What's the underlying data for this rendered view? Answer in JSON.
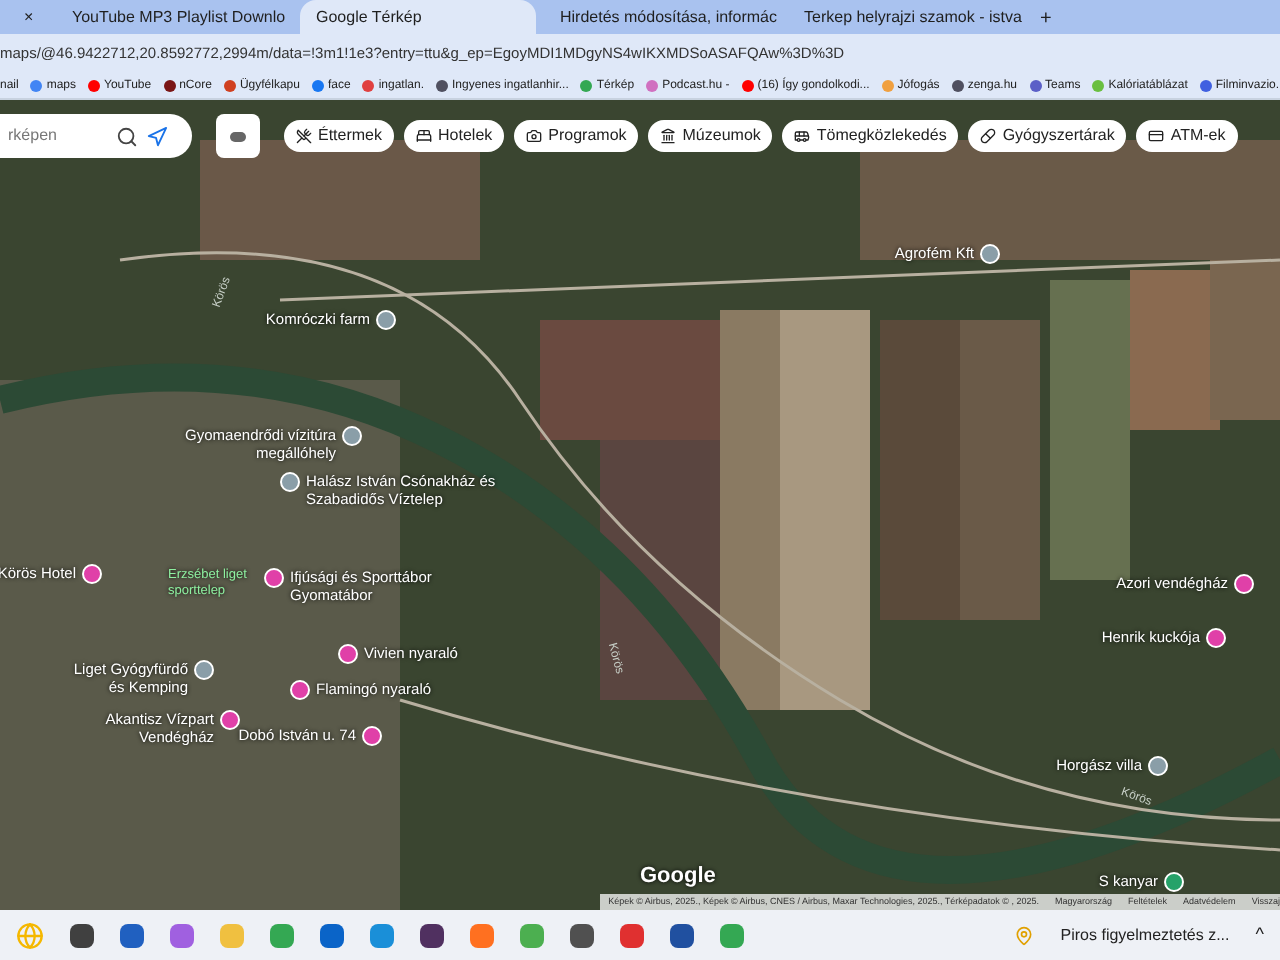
{
  "tabs": [
    {
      "label": "×",
      "selected": false
    },
    {
      "label": "YouTube MP3 Playlist Downlo",
      "selected": false
    },
    {
      "label": "Google Térkép",
      "selected": true
    },
    {
      "label": "Hirdetés módosítása, informác",
      "selected": false
    },
    {
      "label": "Terkep helyrajzi szamok - istva",
      "selected": false
    }
  ],
  "new_tab": "+",
  "address": "maps/@46.9422712,20.8592772,2994m/data=!3m1!1e3?entry=ttu&g_ep=EgoyMDI1MDgyNS4wIKXMDSoASAFQAw%3D%3D",
  "bookmarks": [
    "nail",
    "maps",
    "YouTube",
    "nCore",
    "Ügyfélkapu",
    "face",
    "ingatlan.",
    "Ingyenes ingatlanhir...",
    "Térkép",
    "Podcast.hu -",
    "(16) Így gondolkodi...",
    "Jófogás",
    "zenga.hu",
    "Teams",
    "Kalóriatáblázat",
    "Filminvazio."
  ],
  "map": {
    "search": {
      "placeholder": "rképen"
    },
    "chips": [
      "Éttermek",
      "Hotelek",
      "Programok",
      "Múzeumok",
      "Tömegközlekedés",
      "Gyógyszertárak",
      "ATM-ek"
    ],
    "places": [
      {
        "name": "Komróczki farm",
        "color": "#8a9ea8"
      },
      {
        "name": "Gyomaendrődi vízitúra megállóhely",
        "color": "#8a9ea8"
      },
      {
        "name": "Halász István Csónakház és Szabadidős Víztelep",
        "color": "#8a9ea8"
      },
      {
        "name": "Agrofém Kft",
        "color": "#8a9ea8"
      },
      {
        "name": "Körös Hotel",
        "color": "#e040a8"
      },
      {
        "name": "Ifjúsági és Sporttábor Gyomatábor",
        "color": "#e040a8"
      },
      {
        "name": "Liget Gyógyfürdő és Kemping",
        "color": "#8a9ea8"
      },
      {
        "name": "Vivien nyaraló",
        "color": "#e040a8"
      },
      {
        "name": "Flamingó nyaraló",
        "color": "#e040a8"
      },
      {
        "name": "Akantisz Vízpart Vendégház",
        "color": "#e040a8"
      },
      {
        "name": "Dobó István u. 74",
        "color": "#e040a8"
      },
      {
        "name": "Azori vendégház",
        "color": "#e040a8"
      },
      {
        "name": "Henrik kuckója",
        "color": "#e040a8"
      },
      {
        "name": "Horgász villa",
        "color": "#8a9ea8"
      },
      {
        "name": "S kanyar",
        "color": "#26a269"
      }
    ],
    "park_label": "Erzsébet liget sporttelep",
    "river_labels": [
      "Körös",
      "Körös",
      "Körös"
    ],
    "logo": "Google",
    "attribution": "Képek © Airbus, 2025., Képek © Airbus, CNES / Airbus, Maxar Technologies, 2025., Térképadatok © , 2025.",
    "footer_links": [
      "Magyarország",
      "Feltételek",
      "Adatvédelem",
      "Visszaj"
    ]
  },
  "taskbar": {
    "notification": "Piros figyelmeztetés z...",
    "tray": "^"
  }
}
